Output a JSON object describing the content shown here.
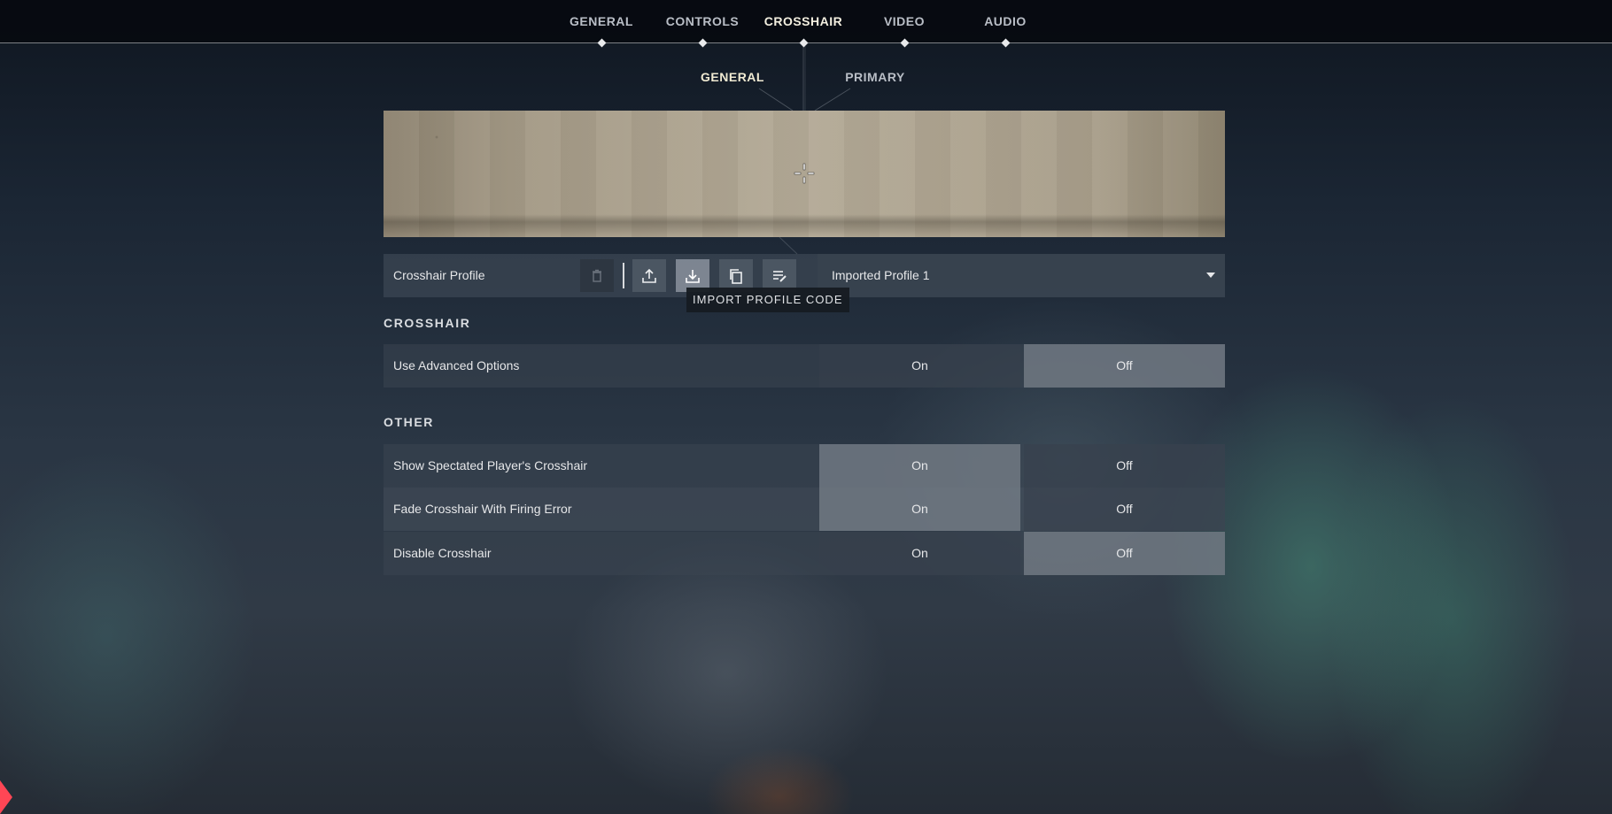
{
  "nav": {
    "tabs": [
      {
        "label": "GENERAL",
        "active": false
      },
      {
        "label": "CONTROLS",
        "active": false
      },
      {
        "label": "CROSSHAIR",
        "active": true
      },
      {
        "label": "VIDEO",
        "active": false
      },
      {
        "label": "AUDIO",
        "active": false
      }
    ],
    "subtabs": [
      {
        "label": "GENERAL",
        "active": true
      },
      {
        "label": "PRIMARY",
        "active": false
      }
    ]
  },
  "profile": {
    "label": "Crosshair Profile",
    "actions": [
      {
        "icon": "trash-icon",
        "enabled": false
      },
      {
        "icon": "export-icon",
        "enabled": true
      },
      {
        "icon": "import-icon",
        "enabled": true,
        "hovered": true
      },
      {
        "icon": "copy-icon",
        "enabled": true
      },
      {
        "icon": "rename-icon",
        "enabled": true
      }
    ],
    "selected": "Imported Profile 1",
    "tooltip": "IMPORT PROFILE CODE"
  },
  "sections": [
    {
      "title": "CROSSHAIR",
      "rows": [
        {
          "label": "Use Advanced Options",
          "on_label": "On",
          "off_label": "Off",
          "value": "Off"
        }
      ]
    },
    {
      "title": "OTHER",
      "rows": [
        {
          "label": "Show Spectated Player's Crosshair",
          "on_label": "On",
          "off_label": "Off",
          "value": "On"
        },
        {
          "label": "Fade Crosshair With Firing Error",
          "on_label": "On",
          "off_label": "Off",
          "value": "On"
        },
        {
          "label": "Disable Crosshair",
          "on_label": "On",
          "off_label": "Off",
          "value": "Off"
        }
      ]
    }
  ],
  "colors": {
    "accent": "#ff4655",
    "crosshair": "#ffffff"
  }
}
